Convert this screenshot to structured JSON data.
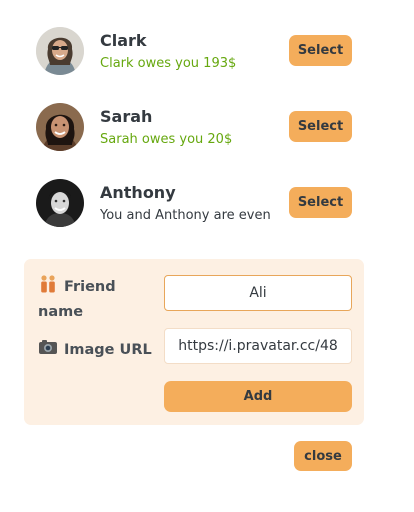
{
  "friends": [
    {
      "name": "Clark",
      "balance": "Clark owes you 193$",
      "balance_type": "green",
      "select_label": "Select",
      "avatar_icon": "clark-avatar-photo"
    },
    {
      "name": "Sarah",
      "balance": "Sarah owes you 20$",
      "balance_type": "green",
      "select_label": "Select",
      "avatar_icon": "sarah-avatar-photo"
    },
    {
      "name": "Anthony",
      "balance": "You and Anthony are even",
      "balance_type": "neutral",
      "select_label": "Select",
      "avatar_icon": "anthony-avatar-photo"
    }
  ],
  "form": {
    "name_label": "Friend name",
    "name_emoji": "people-emoji",
    "name_value": "Ali",
    "url_label": "Image URL",
    "url_emoji": "camera-emoji",
    "url_value": "https://i.pravatar.cc/48",
    "add_label": "Add"
  },
  "close_label": "close",
  "colors": {
    "accent": "#f4ad5b",
    "panel_bg": "#fdf0e3",
    "owed_green": "#66a80f",
    "text_dark": "#343a40"
  }
}
